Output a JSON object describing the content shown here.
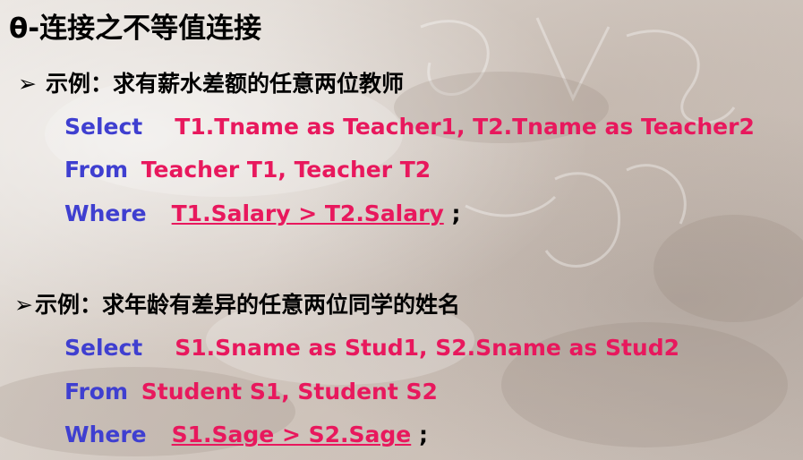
{
  "title": "θ-连接之不等值连接",
  "bullet_glyph": "➢",
  "example1": {
    "heading": "示例：求有薪水差额的任意两位教师",
    "select_kw": "Select",
    "select_expr": "T1.Tname as Teacher1, T2.Tname  as Teacher2",
    "from_kw": "From",
    "from_expr": "Teacher  T1,  Teacher  T2",
    "where_kw": "Where",
    "where_expr": "T1.Salary > T2.Salary",
    "terminator": ";"
  },
  "example2": {
    "heading": "示例：求年龄有差异的任意两位同学的姓名",
    "select_kw": "Select",
    "select_expr": "S1.Sname as Stud1, S2.Sname  as Stud2",
    "from_kw": "From",
    "from_expr": "Student  S1,  Student  S2",
    "where_kw": "Where",
    "where_expr": "S1.Sage > S2.Sage",
    "terminator": ";"
  },
  "colors": {
    "keyword": "#3f3fd0",
    "expression": "#e8185d",
    "text": "#000000"
  }
}
